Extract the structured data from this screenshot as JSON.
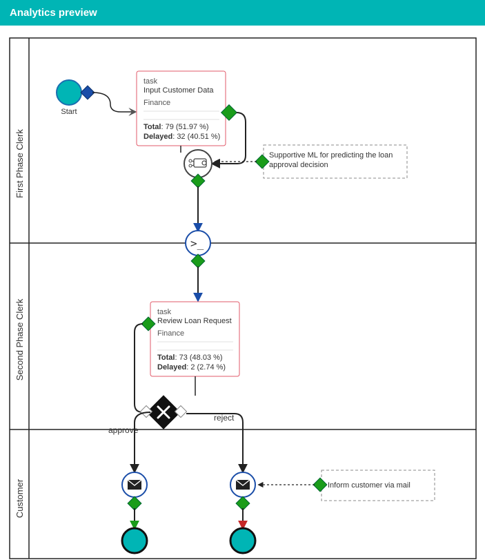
{
  "header": {
    "title": "Analytics preview"
  },
  "lanes": [
    "First Phase Clerk",
    "Second Phase Clerk",
    "Customer"
  ],
  "elements": {
    "start": {
      "label": "Start"
    }
  },
  "tasks": [
    {
      "type": "task",
      "title": "Input Customer Data",
      "category": "Finance",
      "metrics": {
        "total_label": "Total",
        "total_value": ": 79 (51.97 %)",
        "delayed_label": "Delayed",
        "delayed_value": ": 32 (40.51 %)"
      }
    },
    {
      "type": "task",
      "title": "Review Loan Request",
      "category": "Finance",
      "metrics": {
        "total_label": "Total",
        "total_value": ": 73 (48.03 %)",
        "delayed_label": "Delayed",
        "delayed_value": ": 2 (2.74 %)"
      }
    }
  ],
  "branches": {
    "approve": "approve",
    "reject": "reject"
  },
  "annotations": [
    {
      "line1": "Supportive ML for predicting the loan",
      "line2": "approval decision"
    },
    {
      "line1": "Inform customer via mail"
    }
  ],
  "colors": {
    "accent": "#00b5b5",
    "task_border": "#e25a6a",
    "gateway_green": "#1a9c1a",
    "flow_blue": "#1a4da8",
    "flow_red": "#c62828"
  }
}
